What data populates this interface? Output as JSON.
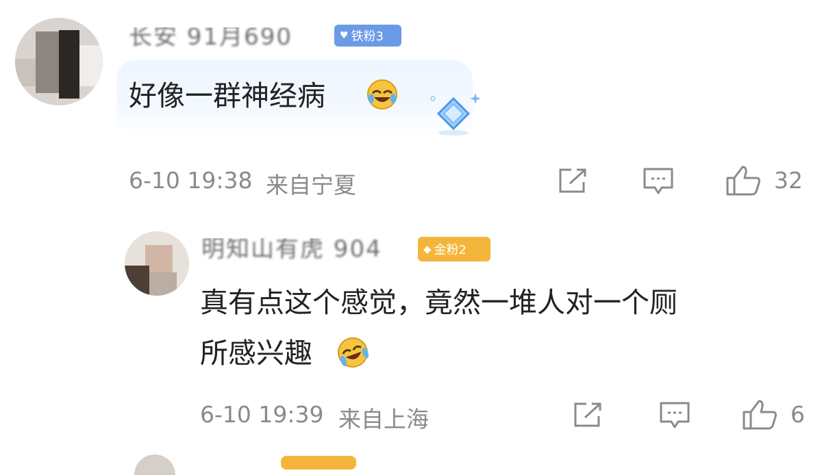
{
  "comments": [
    {
      "username": "长安     91月690",
      "badge": "铁粉3",
      "text": "好像一群神经病",
      "emoji_icon": "laughing-tears-emoji",
      "time": "6-10 19:38",
      "location": "来自宁夏",
      "likes": "32"
    },
    {
      "username": "明知山有虎     904",
      "badge": "金粉2",
      "text_line1": "真有点这个感觉，竟然一堆人对一个厕",
      "text_line2": "所感兴趣",
      "emoji_icon": "crying-laughing-emoji",
      "time": "6-10 19:39",
      "location": "来自上海",
      "likes": "6"
    }
  ],
  "colors": {
    "iron_badge": "#6b9be6",
    "gold_badge": "#f4b63a",
    "meta_text": "#8a8a8a"
  },
  "icons": [
    "share-icon",
    "comment-icon",
    "like-icon",
    "diamond-decoration-icon"
  ]
}
